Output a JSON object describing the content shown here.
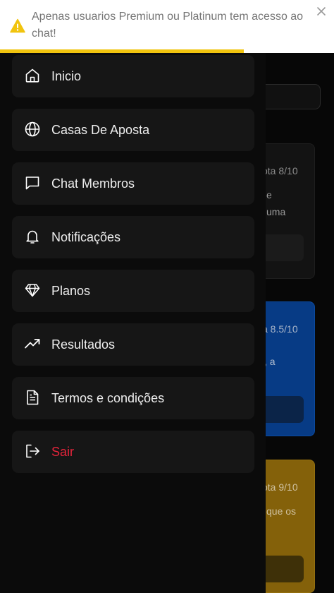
{
  "toast": {
    "icon": "warning-icon",
    "message": "Apenas usuarios Premium ou Platinum tem acesso ao chat!",
    "close_icon": "close-icon",
    "progress_percent": 73,
    "accent_color": "#f1c40f"
  },
  "menu": {
    "items": [
      {
        "label": "Inicio",
        "icon": "home-icon"
      },
      {
        "label": "Casas De Aposta",
        "icon": "globe-icon"
      },
      {
        "label": "Chat Membros",
        "icon": "chat-icon"
      },
      {
        "label": "Notificações",
        "icon": "bell-icon"
      },
      {
        "label": "Planos",
        "icon": "diamond-icon"
      },
      {
        "label": "Resultados",
        "icon": "trending-up-icon"
      },
      {
        "label": "Termos e condições",
        "icon": "document-icon"
      },
      {
        "label": "Sair",
        "icon": "logout-icon",
        "color": "#e5243b"
      }
    ]
  },
  "background_cards": [
    {
      "rating": "ota 8/10",
      "text_lines": [
        "e",
        "uma"
      ]
    },
    {
      "rating": "a 8.5/10",
      "text_lines": [
        "s, a"
      ]
    },
    {
      "rating": "ota 9/10",
      "text_lines": [
        "que os"
      ]
    }
  ]
}
